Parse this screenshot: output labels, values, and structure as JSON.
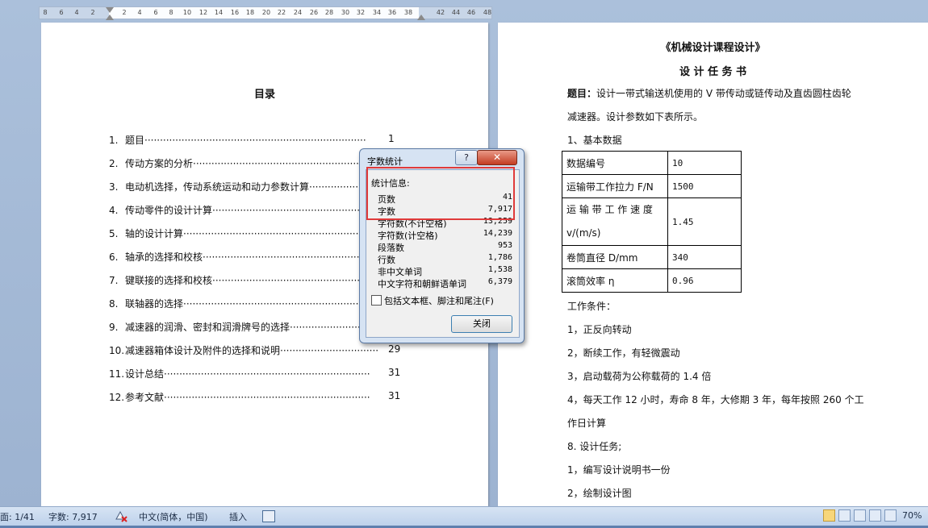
{
  "ruler": {
    "ticks": [
      "8",
      "6",
      "4",
      "2",
      "2",
      "4",
      "6",
      "8",
      "10",
      "12",
      "14",
      "16",
      "18",
      "20",
      "22",
      "24",
      "26",
      "28",
      "30",
      "32",
      "34",
      "36",
      "38",
      "42",
      "44",
      "46",
      "48"
    ]
  },
  "left_page": {
    "toc_title": "目录",
    "toc": [
      {
        "num": "1.",
        "text": "题目",
        "page": "1"
      },
      {
        "num": "2.",
        "text": "传动方案的分析",
        "page": ""
      },
      {
        "num": "3.",
        "text": "电动机选择，传动系统运动和动力参数计算",
        "page": ""
      },
      {
        "num": "4.",
        "text": "传动零件的设计计算",
        "page": ""
      },
      {
        "num": "5.",
        "text": "轴的设计计算",
        "page": ""
      },
      {
        "num": "6.",
        "text": "轴承的选择和校核",
        "page": ""
      },
      {
        "num": "7.",
        "text": "键联接的选择和校核",
        "page": ""
      },
      {
        "num": "8.",
        "text": "联轴器的选择",
        "page": ""
      },
      {
        "num": "9.",
        "text": "减速器的润滑、密封和润滑牌号的选择",
        "page": ""
      },
      {
        "num": "10.",
        "text": "减速器箱体设计及附件的选择和说明",
        "page": "29"
      },
      {
        "num": "11.",
        "text": "设计总结",
        "page": "31"
      },
      {
        "num": "12.",
        "text": "参考文献",
        "page": "31"
      }
    ]
  },
  "right_page": {
    "title": "《机械设计课程设计》",
    "subtitle": "设 计 任 务 书",
    "topic_label": "题目：",
    "topic_text": "设计一带式输送机使用的 V 带传动或链传动及直齿圆柱齿轮",
    "topic_text2": "减速器。设计参数如下表所示。",
    "section1": "1、基本数据",
    "table": [
      {
        "k": "数据编号",
        "v": "10"
      },
      {
        "k": "运输带工作拉力 F/N",
        "v": "1500"
      },
      {
        "k": "运 输 带 工 作 速 度",
        "k2": "v/(m/s)",
        "v": "1.45"
      },
      {
        "k": "卷筒直径 D/mm",
        "v": "340"
      },
      {
        "k": "滚筒效率 η",
        "v": "0.96"
      }
    ],
    "conditions_title": "工作条件：",
    "conditions": [
      "1，正反向转动",
      "2，断续工作，有轻微震动",
      "3，启动载荷为公称载荷的 1.4 倍",
      "4，每天工作 12 小时，寿命 8 年，大修期 3 年，每年按照 260 个工",
      "作日计算"
    ],
    "tasks_title": "8. 设计任务;",
    "tasks": [
      "1，编写设计说明书一份",
      "2，绘制设计图"
    ]
  },
  "dialog": {
    "title": "字数统计",
    "help": "?",
    "close_x": "✕",
    "stats_label": "统计信息:",
    "stats": [
      {
        "label": "页数",
        "value": "41"
      },
      {
        "label": "字数",
        "value": "7,917"
      },
      {
        "label": "字符数(不计空格)",
        "value": "13,259"
      },
      {
        "label": "字符数(计空格)",
        "value": "14,239"
      },
      {
        "label": "段落数",
        "value": "953"
      },
      {
        "label": "行数",
        "value": "1,786"
      },
      {
        "label": "非中文单词",
        "value": "1,538"
      },
      {
        "label": "中文字符和朝鲜语单词",
        "value": "6,379"
      }
    ],
    "checkbox_label": "包括文本框、脚注和尾注(F)",
    "ok_label": "关闭"
  },
  "statusbar": {
    "page": "面: 1/41",
    "words": "字数: 7,917",
    "language": "中文(简体，中国)",
    "mode": "插入",
    "zoom": "70%"
  }
}
